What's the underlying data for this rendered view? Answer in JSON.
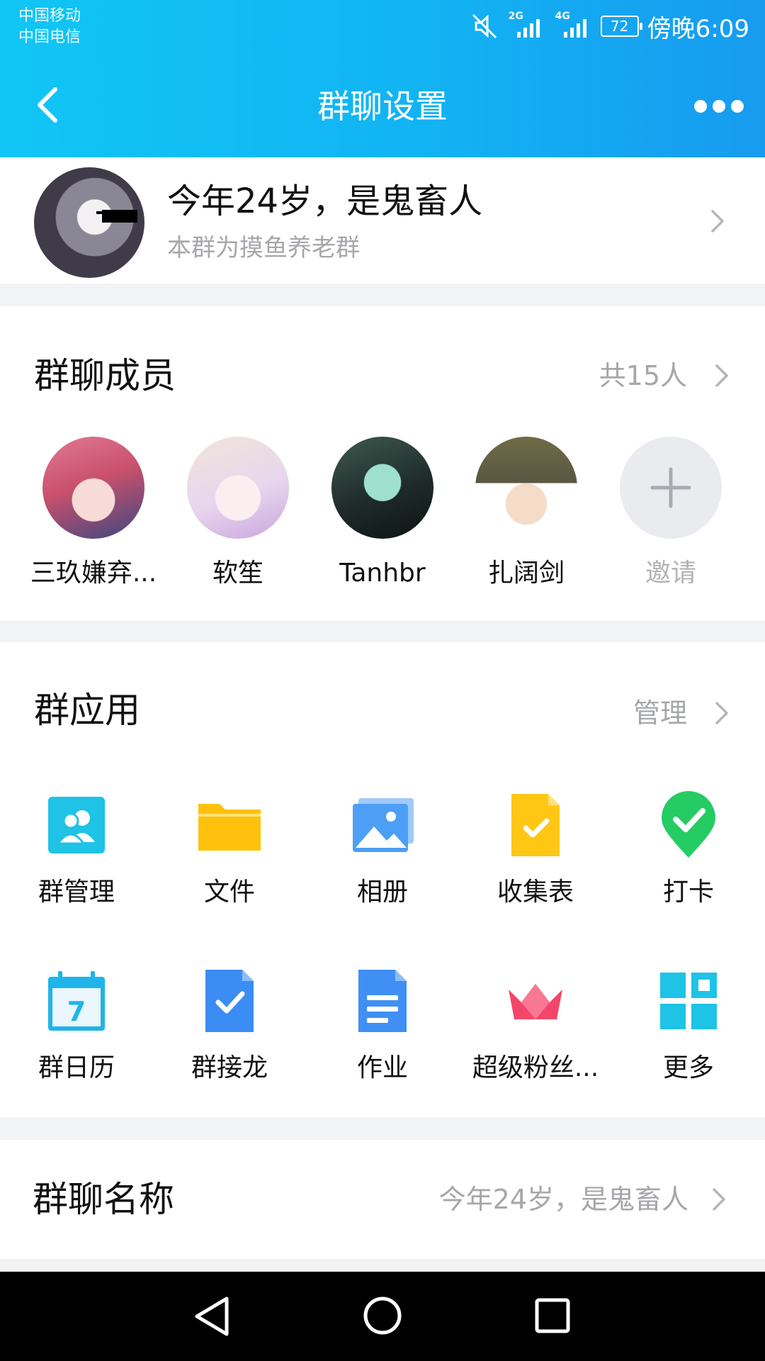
{
  "status_bar": {
    "carrier_1": "中国移动",
    "carrier_2": "中国电信",
    "net_1": "2G",
    "net_2": "4G",
    "battery": "72",
    "time": "傍晚6:09"
  },
  "nav": {
    "title": "群聊设置"
  },
  "group": {
    "name": "今年24岁，是鬼畜人",
    "description": "本群为摸鱼养老群"
  },
  "members": {
    "title": "群聊成员",
    "count_label": "共15人",
    "items": [
      {
        "name": "三玖嫌弃..."
      },
      {
        "name": "软笙"
      },
      {
        "name": "Tanhbr"
      },
      {
        "name": "扎阔剑"
      }
    ],
    "invite_label": "邀请"
  },
  "apps": {
    "title": "群应用",
    "manage_label": "管理",
    "items": [
      {
        "label": "群管理",
        "icon": "group-manage-icon",
        "color": "#1ec3e6"
      },
      {
        "label": "文件",
        "icon": "folder-icon",
        "color": "#ffc10d"
      },
      {
        "label": "相册",
        "icon": "photo-album-icon",
        "color": "#4d9ff5"
      },
      {
        "label": "收集表",
        "icon": "form-icon",
        "color": "#ffc714"
      },
      {
        "label": "打卡",
        "icon": "check-in-icon",
        "color": "#25cc63"
      },
      {
        "label": "群日历",
        "icon": "calendar-icon",
        "color": "#1fb5ea",
        "day": "7"
      },
      {
        "label": "群接龙",
        "icon": "solitaire-icon",
        "color": "#3b8df3"
      },
      {
        "label": "作业",
        "icon": "homework-icon",
        "color": "#3f8ff5"
      },
      {
        "label": "超级粉丝...",
        "icon": "crown-icon",
        "color": "#f2476a"
      },
      {
        "label": "更多",
        "icon": "more-apps-icon",
        "color": "#1ec3e6"
      }
    ]
  },
  "group_name_row": {
    "title": "群聊名称",
    "value": "今年24岁，是鬼畜人"
  }
}
